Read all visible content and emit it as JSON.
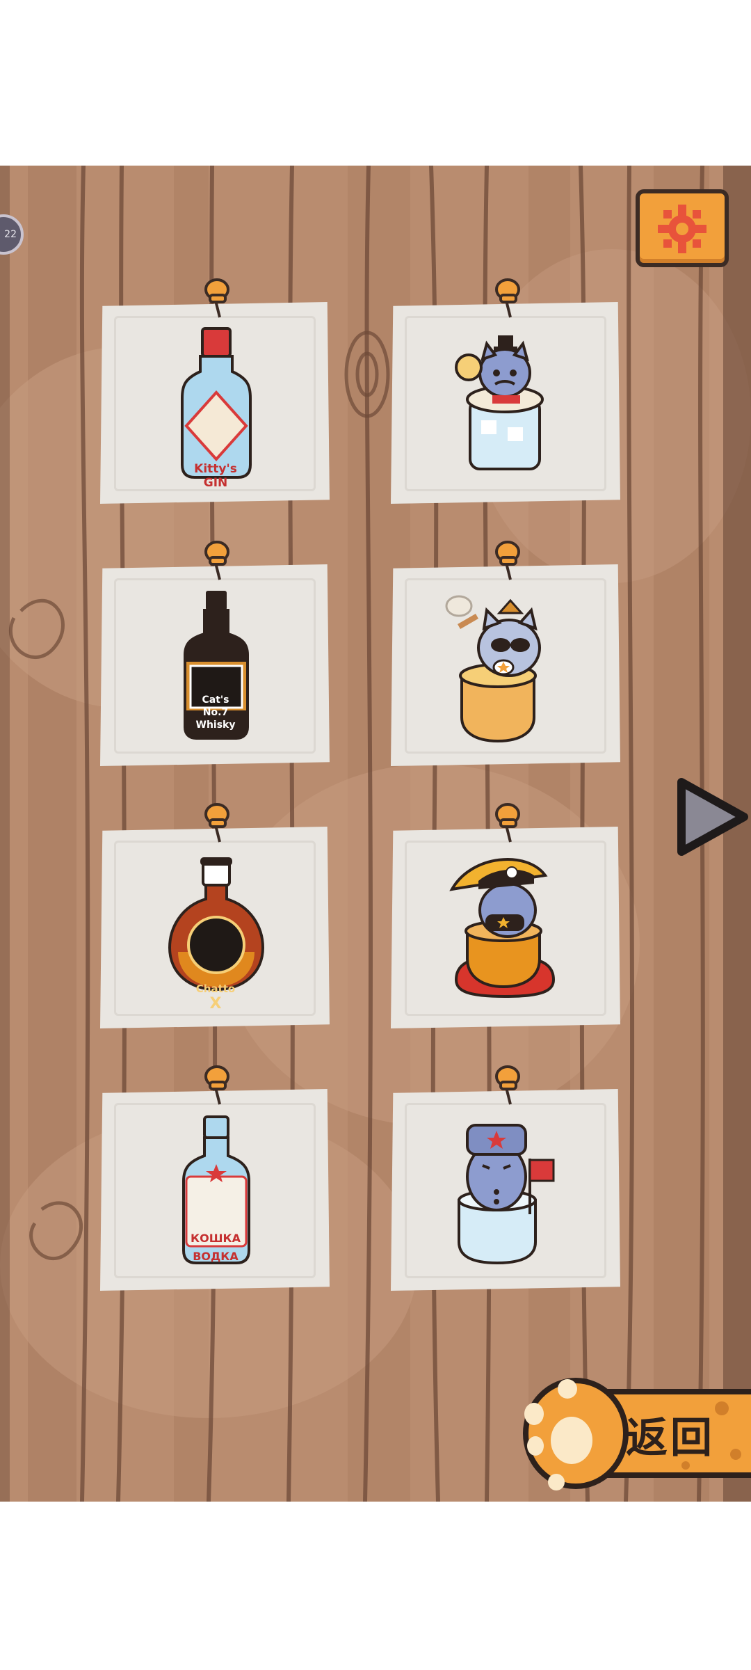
{
  "level_badge": "22",
  "cards": [
    {
      "id": "gin",
      "label_lines": [
        "Kitty's",
        "GIN"
      ],
      "icon": "gin-bottle-icon",
      "col": "left"
    },
    {
      "id": "gin-cat",
      "label_lines": [],
      "icon": "cat-in-gin-glass-icon",
      "col": "right"
    },
    {
      "id": "whisky",
      "label_lines": [
        "Cat's",
        "No.7",
        "Whisky"
      ],
      "icon": "whisky-bottle-icon",
      "col": "left"
    },
    {
      "id": "whisky-cat",
      "label_lines": [],
      "icon": "cowboy-cat-in-whisky-glass-icon",
      "col": "right"
    },
    {
      "id": "cognac",
      "label_lines": [
        "Chatto",
        "X"
      ],
      "icon": "cognac-bottle-icon",
      "col": "left"
    },
    {
      "id": "cognac-cat",
      "label_lines": [],
      "icon": "napoleon-cat-in-cognac-glass-icon",
      "col": "right"
    },
    {
      "id": "vodka",
      "label_lines": [
        "КОШКА",
        "ВОДКА"
      ],
      "icon": "vodka-bottle-icon",
      "col": "left"
    },
    {
      "id": "vodka-cat",
      "label_lines": [],
      "icon": "soldier-cat-in-vodka-glass-icon",
      "col": "right"
    }
  ],
  "back_button": {
    "label": "返回"
  },
  "colors": {
    "wood": "#b98c6f",
    "paper": "#e9e6e1",
    "accent": "#f2a03b",
    "outline": "#3b2b24"
  }
}
